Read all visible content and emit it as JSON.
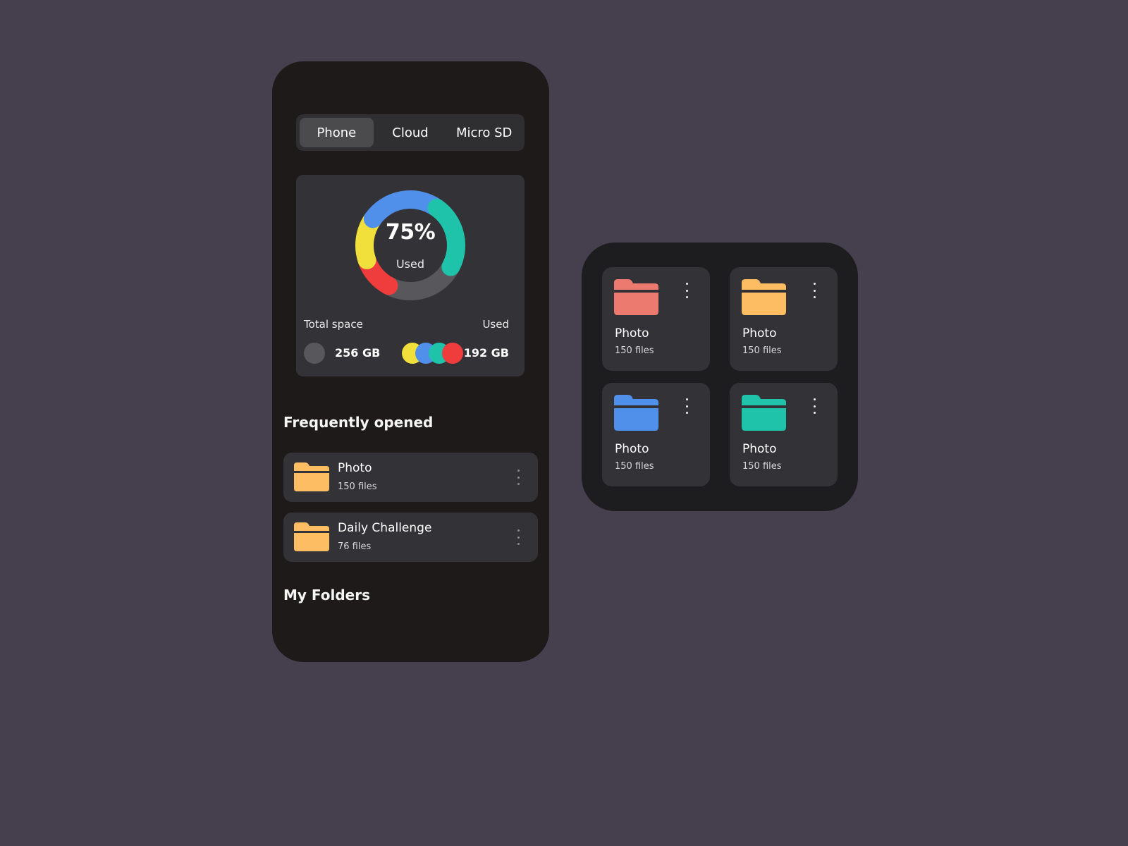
{
  "storage_tabs": [
    {
      "label": "Phone",
      "active": true
    },
    {
      "label": "Cloud",
      "active": false
    },
    {
      "label": "Micro SD",
      "active": false
    }
  ],
  "storage": {
    "used_percent_label": "75%",
    "used_caption": "Used",
    "used_fraction": 0.75,
    "total_space_label": "Total space",
    "used_label": "Used",
    "total_value": "256 GB",
    "used_value": "192 GB",
    "segments": [
      {
        "color": "#ef3c3c",
        "fraction": 0.12
      },
      {
        "color": "#f1df3c",
        "fraction": 0.15
      },
      {
        "color": "#5190ea",
        "fraction": 0.25
      },
      {
        "color": "#1fc3a9",
        "fraction": 0.23
      }
    ],
    "track_color": "#58575b",
    "legend_colors": [
      "#f1df3c",
      "#5190ea",
      "#1fc3a9",
      "#ef3c3c"
    ]
  },
  "frequently_opened": {
    "title": "Frequently opened",
    "items": [
      {
        "name": "Photo",
        "count": "150 files",
        "icon": "folder-icon",
        "color": "#fdbd63"
      },
      {
        "name": "Daily Challenge",
        "count": "76 files",
        "icon": "folder-icon",
        "color": "#fdbd63"
      }
    ]
  },
  "my_folders": {
    "title": "My Folders"
  },
  "folder_grid": [
    {
      "name": "Photo",
      "count": "150 files",
      "icon": "folder-icon",
      "color": "#ec7a6e"
    },
    {
      "name": "Photo",
      "count": "150 files",
      "icon": "folder-icon",
      "color": "#fdbd63"
    },
    {
      "name": "Photo",
      "count": "150 files",
      "icon": "folder-icon",
      "color": "#5190ea"
    },
    {
      "name": "Photo",
      "count": "150 files",
      "icon": "folder-icon",
      "color": "#1fc3a9"
    }
  ],
  "colors": {
    "background": "#463f4e",
    "phone_surface": "#1e1a1a",
    "card_surface": "#333236"
  }
}
